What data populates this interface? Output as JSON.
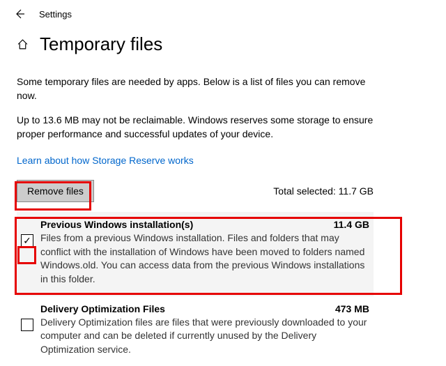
{
  "header": {
    "settings_label": "Settings"
  },
  "title": "Temporary files",
  "desc1": "Some temporary files are needed by apps. Below is a list of files you can remove now.",
  "desc2": "Up to 13.6 MB may not be reclaimable. Windows reserves some storage to ensure proper performance and successful updates of your device.",
  "link": "Learn about how Storage Reserve works",
  "remove_label": "Remove files",
  "total_prefix": "Total selected: ",
  "total_value": "11.7 GB",
  "items": [
    {
      "title": "Previous Windows installation(s)",
      "size": "11.4 GB",
      "desc": "Files from a previous Windows installation.  Files and folders that may conflict with the installation of Windows have been moved to folders named Windows.old.  You can access data from the previous Windows installations in this folder.",
      "checked": "✓"
    },
    {
      "title": "Delivery Optimization Files",
      "size": "473 MB",
      "desc": "Delivery Optimization files are files that were previously downloaded to your computer and can be deleted if currently unused by the Delivery Optimization service.",
      "checked": ""
    }
  ]
}
